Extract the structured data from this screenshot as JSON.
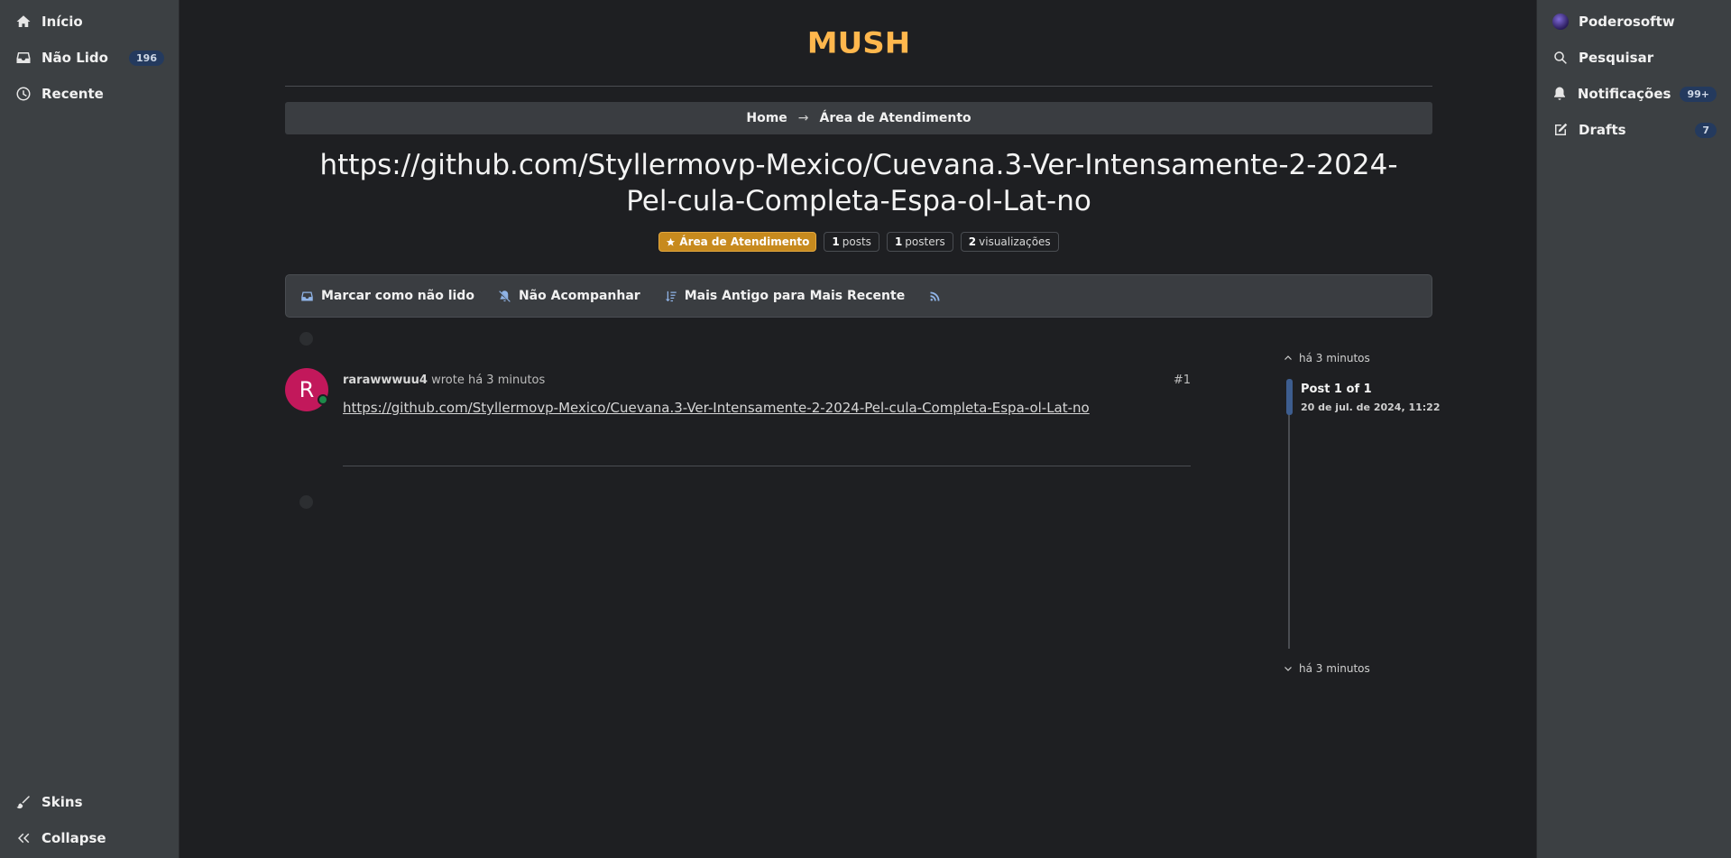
{
  "left_nav": {
    "items": [
      {
        "label": "Início",
        "icon": "home-icon"
      },
      {
        "label": "Não Lido",
        "icon": "inbox-icon",
        "badge": "196"
      },
      {
        "label": "Recente",
        "icon": "clock-icon"
      }
    ],
    "bottom": [
      {
        "label": "Skins",
        "icon": "paintbrush-icon"
      },
      {
        "label": "Collapse",
        "icon": "double-chevron-left-icon"
      }
    ]
  },
  "right_nav": {
    "user": "Poderosoftw",
    "search": "Pesquisar",
    "notifications": {
      "label": "Notificações",
      "badge": "99+"
    },
    "drafts": {
      "label": "Drafts",
      "badge": "7"
    }
  },
  "logo": "MUSH",
  "breadcrumb": {
    "home": "Home",
    "separator": "→",
    "current": "Área de Atendimento"
  },
  "topic": {
    "title": "https://github.com/Styllermovp-Mexico/Cuevana.3-Ver-Intensamente-2-2024-Pel-cula-Completa-Espa-ol-Lat-no",
    "category": "Área de Atendimento",
    "stats": [
      {
        "value": "1",
        "label": "posts"
      },
      {
        "value": "1",
        "label": "posters"
      },
      {
        "value": "2",
        "label": "visualizações"
      }
    ]
  },
  "toolbar": {
    "mark_unread": "Marcar como não lido",
    "unwatch": "Não Acompanhar",
    "sort": "Mais Antigo para Mais Recente"
  },
  "post": {
    "avatar_letter": "R",
    "author": "rarawwwuu4",
    "wrote": "wrote há 3 minutos",
    "index": "#1",
    "content": "https://github.com/Styllermovp-Mexico/Cuevana.3-Ver-Intensamente-2-2024-Pel-cula-Completa-Espa-ol-Lat-no"
  },
  "timeline": {
    "top_time": "há 3 minutos",
    "post_label": "Post 1 of 1",
    "date": "20 de jul. de 2024, 11:22",
    "bottom_time": "há 3 minutos"
  },
  "colors": {
    "accent": "#ffb74d",
    "category": "#c78a1e",
    "badge": "#243a5e",
    "avatar": "#c2185b"
  }
}
